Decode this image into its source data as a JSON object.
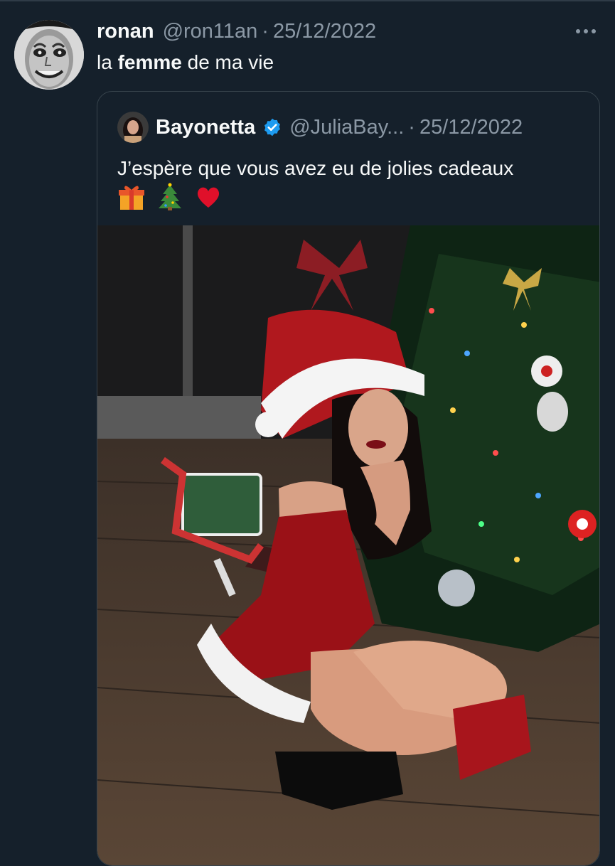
{
  "tweet": {
    "author_name": "ronan",
    "author_handle": "@ron11an",
    "separator": "·",
    "date": "25/12/2022",
    "text_before": "la ",
    "text_bold": "femme",
    "text_after": " de ma vie"
  },
  "quote": {
    "author_name": "Bayonetta",
    "author_handle": "@JuliaBay...",
    "separator": "·",
    "date": "25/12/2022",
    "text": "J’espère que vous avez eu de jolies cadeaux",
    "emojis": [
      "gift-icon",
      "christmas-tree-icon",
      "red-heart-icon"
    ],
    "verified": true
  },
  "colors": {
    "background": "#15202b",
    "text": "#f7f9f9",
    "secondary_text": "#8b98a5",
    "border": "#38444d",
    "verified": "#1d9bf0"
  }
}
